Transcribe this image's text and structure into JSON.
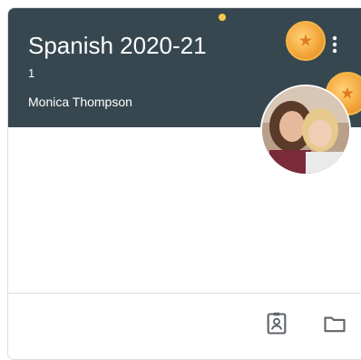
{
  "card": {
    "title": "Spanish 2020-21",
    "section": "1",
    "teacher": "Monica Thompson"
  },
  "icons": {
    "more": "more-vert-icon",
    "portfolio": "assignment-ind-icon",
    "folder": "folder-icon"
  },
  "colors": {
    "header": "#37474f",
    "coin": "#f4a73b"
  }
}
